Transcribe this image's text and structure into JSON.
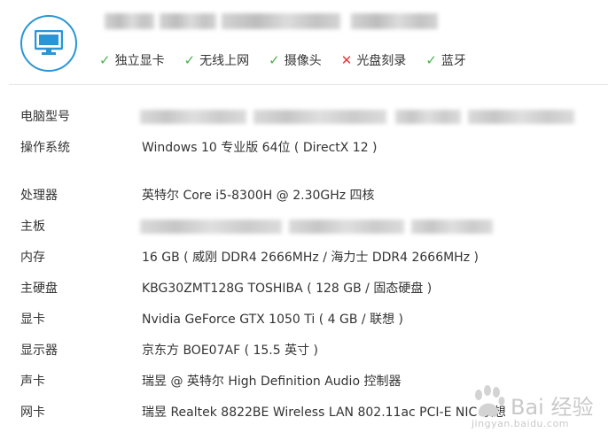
{
  "header": {
    "icon": "monitor-icon",
    "features": [
      {
        "label": "独立显卡",
        "ok": true
      },
      {
        "label": "无线上网",
        "ok": true
      },
      {
        "label": "摄像头",
        "ok": true
      },
      {
        "label": "光盘刻录",
        "ok": false
      },
      {
        "label": "蓝牙",
        "ok": true
      }
    ],
    "colors": {
      "accent": "#2a95d6",
      "yes": "#4caf50",
      "no": "#e53935"
    }
  },
  "specs": [
    {
      "label": "电脑型号",
      "value": ""
    },
    {
      "label": "操作系统",
      "value": "Windows 10 专业版 64位 ( DirectX 12 )"
    },
    {
      "label": "处理器",
      "value": "英特尔 Core i5-8300H @ 2.30GHz 四核"
    },
    {
      "label": "主板",
      "value": ""
    },
    {
      "label": "内存",
      "value": "16 GB ( 威刚 DDR4 2666MHz / 海力士 DDR4 2666MHz )"
    },
    {
      "label": "主硬盘",
      "value": " KBG30ZMT128G TOSHIBA ( 128 GB / 固态硬盘 )"
    },
    {
      "label": "显卡",
      "value": "Nvidia GeForce GTX 1050 Ti ( 4 GB / 联想 )"
    },
    {
      "label": "显示器",
      "value": "京东方 BOE07AF ( 15.5 英寸 )"
    },
    {
      "label": "声卡",
      "value": "瑞昱 @ 英特尔 High Definition Audio 控制器"
    },
    {
      "label": "网卡",
      "value": "瑞昱 Realtek 8822BE Wireless LAN 802.11ac PCI-E NIC  联想"
    }
  ],
  "watermark": {
    "line1": "Bai 经验",
    "line2": "jingyan.baidu.com"
  }
}
